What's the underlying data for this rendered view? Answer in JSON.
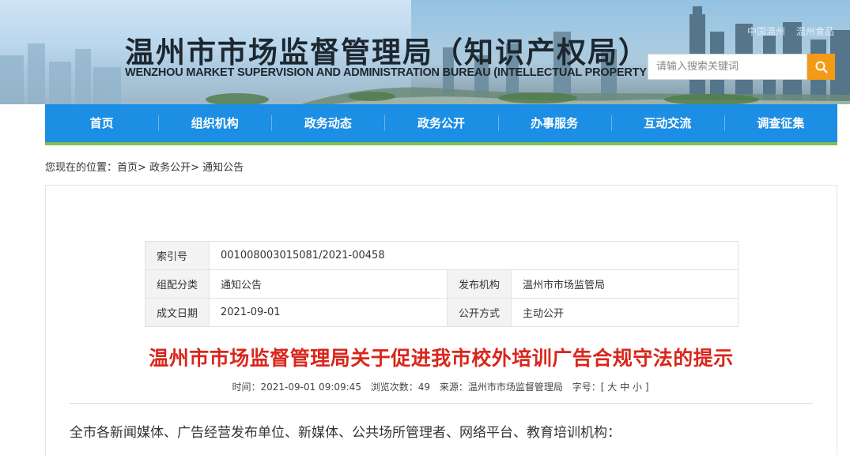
{
  "header": {
    "title": "温州市市场监督管理局（知识产权局）",
    "subtitle": "WENZHOU MARKET SUPERVISION AND ADMINISTRATION BUREAU (INTELLECTUAL PROPERTY OFFICE)",
    "top_links": [
      "中国温州",
      "温州食品"
    ],
    "search_placeholder": "请输入搜索关键词",
    "search_icon": "search-icon",
    "accent_color": "#f39b16"
  },
  "nav": {
    "color": "#1c8ee3",
    "items": [
      "首页",
      "组织机构",
      "政务动态",
      "政务公开",
      "办事服务",
      "互动交流",
      "调查征集"
    ]
  },
  "breadcrumb": {
    "prefix": "您现在的位置：",
    "items": [
      "首页",
      "政务公开",
      "通知公告"
    ],
    "separator": ">"
  },
  "meta": {
    "index_label": "索引号",
    "index_value": "001008003015081/2021-00458",
    "category_label": "组配分类",
    "category_value": "通知公告",
    "publisher_label": "发布机构",
    "publisher_value": "温州市市场监管局",
    "date_label": "成文日期",
    "date_value": "2021-09-01",
    "disclosure_label": "公开方式",
    "disclosure_value": "主动公开"
  },
  "article": {
    "title": "温州市市场监督管理局关于促进我市校外培训广告合规守法的提示",
    "title_color": "#d9261c",
    "time_label": "时间：",
    "time_value": "2021-09-01 09:09:45",
    "views_label": "浏览次数：",
    "views_value": "49",
    "source_label": "来源：",
    "source_value": "温州市市场监督管理局",
    "font_label": "字号：",
    "font_open": "[",
    "font_sizes": [
      "大",
      "中",
      "小"
    ],
    "font_close": "]",
    "body_first_line": "全市各新闻媒体、广告经营发布单位、新媒体、公共场所管理者、网络平台、教育培训机构："
  }
}
